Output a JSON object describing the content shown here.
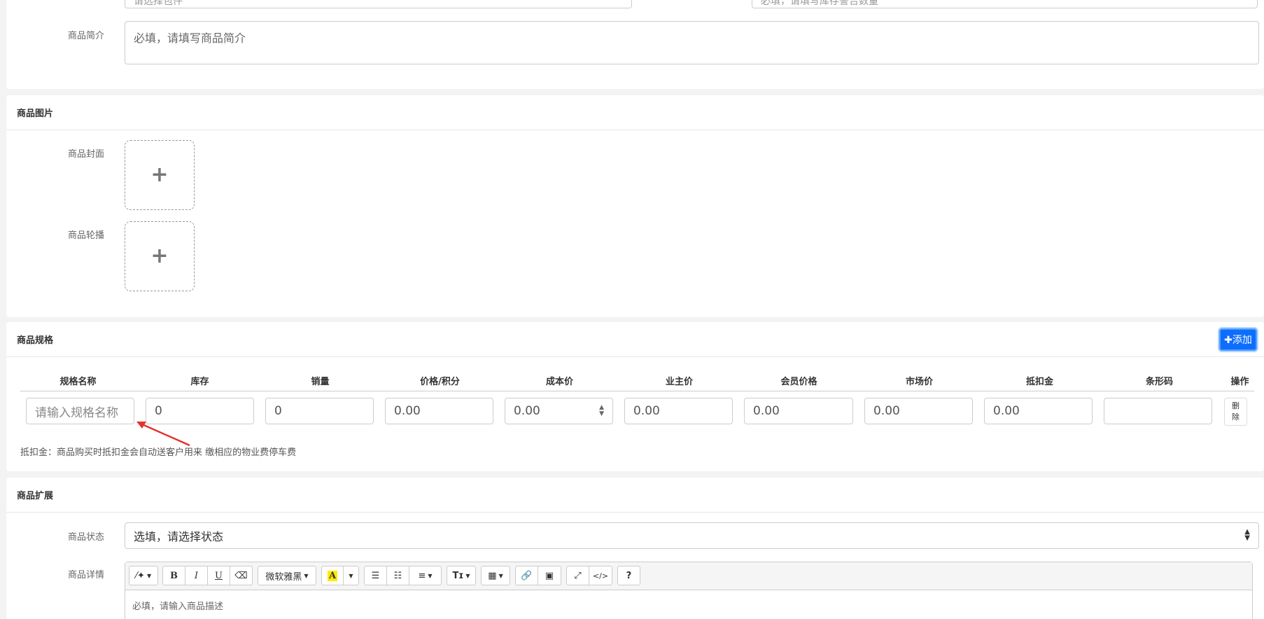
{
  "basic": {
    "top_left_input": "请选择包件",
    "top_right_input": "必填，请填写库存警告数量",
    "intro_label": "商品简介",
    "intro_placeholder": "必填，请填写商品简介"
  },
  "images": {
    "title": "商品图片",
    "cover_label": "商品封面",
    "carousel_label": "商品轮播",
    "plus": "+"
  },
  "spec": {
    "title": "商品规格",
    "add_button": "✚添加",
    "columns": [
      "规格名称",
      "库存",
      "销量",
      "价格/积分",
      "成本价",
      "业主价",
      "会员价格",
      "市场价",
      "抵扣金",
      "条形码",
      "操作"
    ],
    "row": {
      "name_placeholder": "请输入规格名称",
      "stock": "0",
      "sales": "0",
      "price": "0.00",
      "cost": "0.00",
      "owner_price": "0.00",
      "member_price": "0.00",
      "market_price": "0.00",
      "deduction": "0.00",
      "barcode": "",
      "delete_top": "删",
      "delete_bottom": "除"
    },
    "note": "抵扣金：商品购买时抵扣金会自动送客户用来 缴相应的物业费停车费"
  },
  "ext": {
    "title": "商品扩展",
    "status_label": "商品状态",
    "status_value": "选填，请选择状态",
    "detail_label": "商品详情",
    "font_name": "微软雅黑",
    "detail_placeholder": "必填，请输入商品描述"
  },
  "colors": {
    "primary": "#0d6efd",
    "annotation_arrow": "#e5322d"
  }
}
